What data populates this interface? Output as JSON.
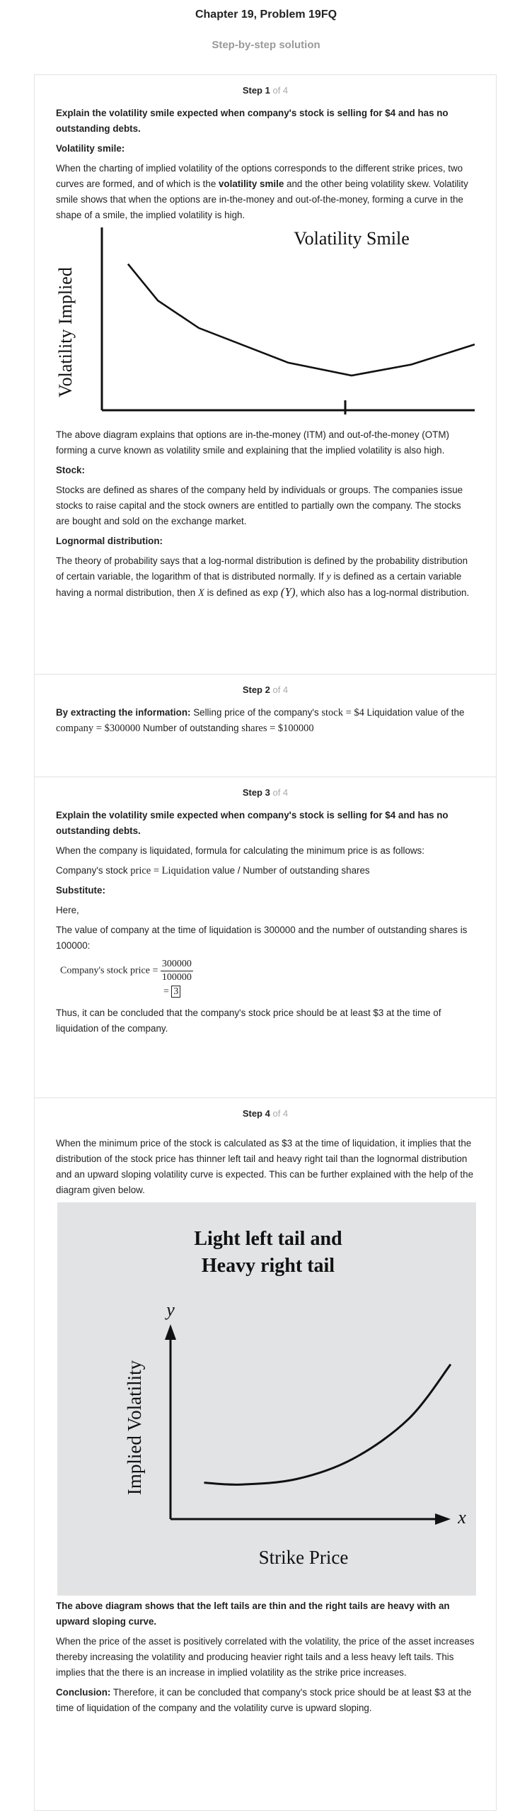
{
  "header": {
    "title": "Chapter 19, Problem 19FQ",
    "subtitle": "Step-by-step solution"
  },
  "steps": [
    {
      "label": "Step 1",
      "of": "of 4",
      "question": "Explain the volatility smile expected when company's stock is selling for $4 and has no outstanding debts.",
      "h_smile": "Volatility smile:",
      "p1_a": "When the charting of implied volatility of the options corresponds to the different strike prices, two curves are formed, and of which is the ",
      "p1_bold": "volatility smile",
      "p1_b": " and the other being volatility skew. Volatility smile shows that when the options are in-the-money and out-of-the-money, forming a curve in the shape of a smile, the implied volatility is high.",
      "chart_title": "Volatility Smile",
      "chart_ylabel": "Volatility Implied",
      "p2": "The above diagram explains that options are in-the-money (ITM) and out-of-the-money (OTM) forming a curve known as volatility smile and explaining that the implied volatility is also high.",
      "h_stock": "Stock:",
      "p3": "Stocks are defined as shares of the company held by individuals or groups. The companies issue stocks to raise capital and the stock owners are entitled to partially own the company. The stocks are bought and sold on the exchange market.",
      "h_lognormal": "Lognormal distribution:",
      "p4_a": "The theory of probability says that a log-normal distribution is defined by the probability distribution of certain variable, the logarithm of that is distributed normally. If ",
      "p4_y": "y",
      "p4_b": " is defined as a certain variable having a normal distribution, then ",
      "p4_x": "X",
      "p4_c": " is defined as exp ",
      "p4_Y": "(Y)",
      "p4_d": ", which also has a log-normal distribution."
    },
    {
      "label": "Step 2",
      "of": "of 4",
      "bold": "By extracting the information:",
      "t1": " Selling price of the company's ",
      "m1": "stock = $4",
      "t2": " Liquidation value of the ",
      "m2": "company = $300000",
      "t3": " Number of outstanding ",
      "m3": "shares = $100000"
    },
    {
      "label": "Step 3",
      "of": "of 4",
      "question": "Explain the volatility smile expected when company's stock is selling for $4 and has no outstanding debts.",
      "p1": "When the company is liquidated, formula for calculating the minimum price is as follows:",
      "p2_a": "Company's stock ",
      "p2_m": "price = Liquidation",
      "p2_b": " value / Number of outstanding shares",
      "h_sub": "Substitute:",
      "here": "Here,",
      "p3": "The value of company at the time of liquidation is 300000 and the number of outstanding shares is 100000:",
      "eq_lhs": "Company's stock price =",
      "eq_num": "300000",
      "eq_den": "100000",
      "eq_eq": "=",
      "eq_result": "3",
      "p4": "Thus, it can be concluded that the company's stock price should be at least $3 at the time of liquidation of the company."
    },
    {
      "label": "Step 4",
      "of": "of 4",
      "p1": "When the minimum price of the stock is calculated as $3 at the time of liquidation, it implies that the distribution of the stock price has thinner left tail and heavy right tail than the lognormal distribution and an upward sloping volatility curve is expected. This can be further explained with the help of the diagram given below.",
      "chart_title_1": "Light left tail and",
      "chart_title_2": "Heavy right tail",
      "chart_y": "y",
      "chart_x": "x",
      "chart_ylabel": "Implied Volatility",
      "chart_xlabel": "Strike Price",
      "p2": "The above diagram shows that the left tails are thin and the right tails are heavy with an upward sloping curve.",
      "p3": "When the price of the asset is positively correlated with the volatility, the price of the asset increases thereby increasing the volatility and producing heavier right tails and a less heavy left tails. This implies that the there is an increase in implied volatility as the strike price increases.",
      "concl_bold": "Conclusion:",
      "concl": " Therefore, it can be concluded that company's stock price should be at least $3 at the time of liquidation of the company and the volatility curve is upward sloping."
    }
  ],
  "chart_data": [
    {
      "type": "line",
      "title": "Volatility Smile",
      "ylabel": "Volatility Implied",
      "xlabel": "",
      "x": [
        0.07,
        0.15,
        0.26,
        0.5,
        0.67,
        0.83,
        1.0
      ],
      "y": [
        0.8,
        0.6,
        0.45,
        0.26,
        0.19,
        0.25,
        0.36
      ],
      "ylim": [
        0,
        1
      ],
      "xlim": [
        0,
        1
      ],
      "grid": false,
      "color": "#111111",
      "background": "#ffffff"
    },
    {
      "type": "line",
      "title": "Light left tail and Heavy right tail",
      "ylabel": "Implied Volatility",
      "xlabel": "Strike Price",
      "x": [
        0.12,
        0.25,
        0.45,
        0.65,
        0.85,
        1.0
      ],
      "y": [
        0.2,
        0.19,
        0.22,
        0.33,
        0.55,
        0.85
      ],
      "ylim": [
        0,
        1
      ],
      "xlim": [
        0,
        1
      ],
      "grid": false,
      "color": "#111111",
      "background": "#e2e3e4"
    }
  ]
}
